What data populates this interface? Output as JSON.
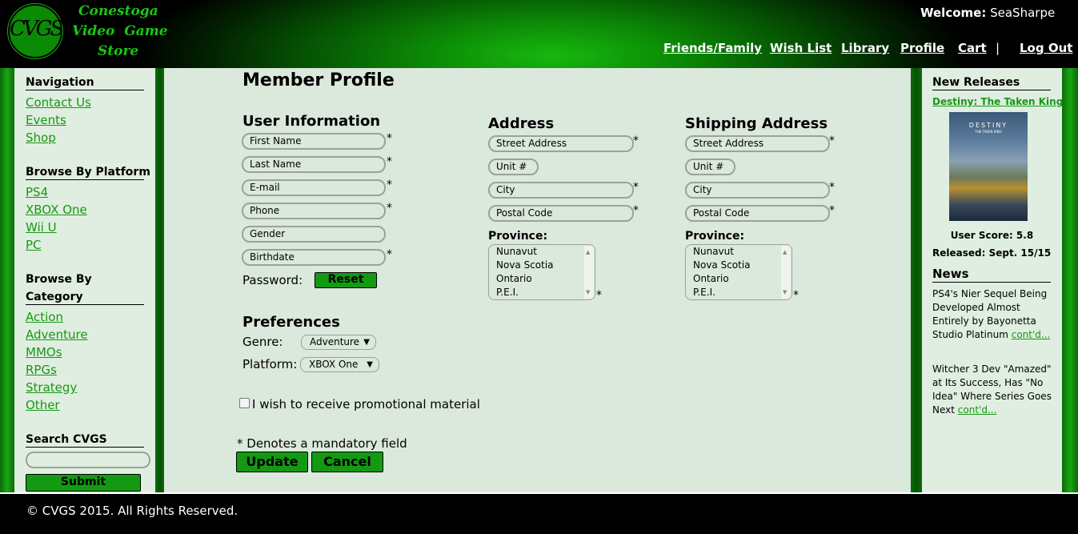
{
  "header": {
    "logo_mark": "CVGS",
    "logo_lines": [
      "Conestoga",
      "Video  Game",
      "Store"
    ],
    "welcome_label": "Welcome:",
    "welcome_user": "SeaSharpe",
    "nav": [
      "Friends/Family",
      "Wish List",
      "Library",
      "Profile",
      "Cart",
      "Log Out"
    ],
    "separator": "|"
  },
  "sidebar_left": {
    "nav_heading": "Navigation",
    "nav_links": [
      "Contact Us",
      "Events",
      "Shop"
    ],
    "platform_heading": "Browse By Platform",
    "platform_links": [
      "PS4",
      "XBOX One",
      "Wii U",
      "PC"
    ],
    "category_heading_1": "Browse By",
    "category_heading_2": "Category",
    "category_links": [
      "Action",
      "Adventure",
      "MMOs",
      "RPGs",
      "Strategy",
      "Other"
    ],
    "search_heading": "Search CVGS",
    "search_value": "",
    "search_submit": "Submit"
  },
  "main": {
    "title": "Member Profile",
    "user_info": {
      "heading": "User Information",
      "fields": [
        "First Name",
        "Last Name",
        "E-mail",
        "Phone",
        "Gender",
        "Birthdate"
      ],
      "password_label": "Password:",
      "reset_label": "Reset"
    },
    "address": {
      "heading": "Address",
      "street": "Street Address",
      "unit": "Unit #",
      "city": "City",
      "postal": "Postal Code",
      "province_label": "Province:",
      "provinces": [
        "Nunavut",
        "Nova Scotia",
        "Ontario",
        "P.E.I."
      ]
    },
    "shipping": {
      "heading": "Shipping Address",
      "street": "Street Address",
      "unit": "Unit #",
      "city": "City",
      "postal": "Postal Code",
      "province_label": "Province:",
      "provinces": [
        "Nunavut",
        "Nova Scotia",
        "Ontario",
        "P.E.I."
      ]
    },
    "required_mark": "*",
    "preferences": {
      "heading": "Preferences",
      "genre_label": "Genre:",
      "genre_value": "Adventure",
      "platform_label": "Platform:",
      "platform_value": "XBOX One"
    },
    "promo_label": "I wish to receive promotional material",
    "mandatory_note": "* Denotes a mandatory field",
    "update_label": "Update",
    "cancel_label": "Cancel"
  },
  "sidebar_right": {
    "releases_heading": "New Releases",
    "release_title": "Destiny: The Taken King",
    "cover_title": "DESTINY",
    "cover_subtitle": "THE TAKEN KING",
    "user_score": "User Score: 5.8",
    "released": "Released: Sept. 15/15",
    "news_heading": "News",
    "news": [
      {
        "text": "PS4's Nier Sequel Being Developed Almost Entirely by Bayonetta Studio Platinum ",
        "more": "cont'd..."
      },
      {
        "text": "Witcher 3 Dev \"Amazed\" at Its Success, Has \"No Idea\" Where Series Goes Next ",
        "more": "cont'd..."
      }
    ]
  },
  "footer": {
    "copyright": "© CVGS 2015. All Rights Reserved."
  }
}
